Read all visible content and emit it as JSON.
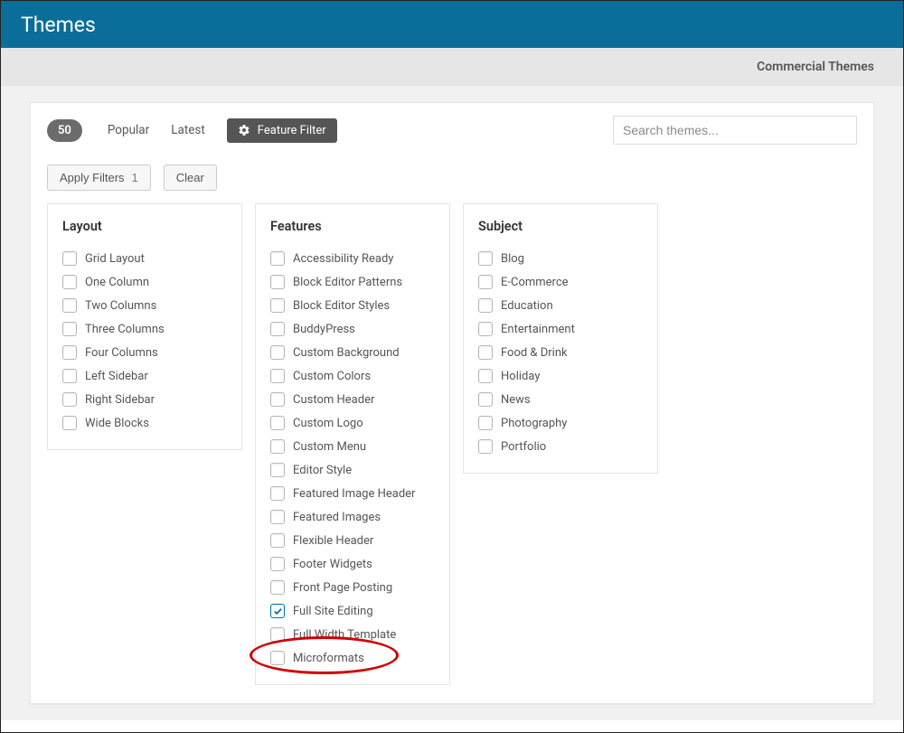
{
  "header": {
    "title": "Themes"
  },
  "commercial_link": "Commercial Themes",
  "topbar": {
    "count": "50",
    "tab_popular": "Popular",
    "tab_latest": "Latest",
    "feature_filter": "Feature Filter"
  },
  "search": {
    "placeholder": "Search themes..."
  },
  "buttons": {
    "apply_filters": "Apply Filters",
    "apply_count": "1",
    "clear": "Clear"
  },
  "panels": {
    "layout": {
      "title": "Layout",
      "items": [
        "Grid Layout",
        "One Column",
        "Two Columns",
        "Three Columns",
        "Four Columns",
        "Left Sidebar",
        "Right Sidebar",
        "Wide Blocks"
      ]
    },
    "features": {
      "title": "Features",
      "items": [
        "Accessibility Ready",
        "Block Editor Patterns",
        "Block Editor Styles",
        "BuddyPress",
        "Custom Background",
        "Custom Colors",
        "Custom Header",
        "Custom Logo",
        "Custom Menu",
        "Editor Style",
        "Featured Image Header",
        "Featured Images",
        "Flexible Header",
        "Footer Widgets",
        "Front Page Posting",
        "Full Site Editing",
        "Full Width Template",
        "Microformats"
      ],
      "checked_index": 15
    },
    "subject": {
      "title": "Subject",
      "items": [
        "Blog",
        "E-Commerce",
        "Education",
        "Entertainment",
        "Food & Drink",
        "Holiday",
        "News",
        "Photography",
        "Portfolio"
      ]
    }
  }
}
